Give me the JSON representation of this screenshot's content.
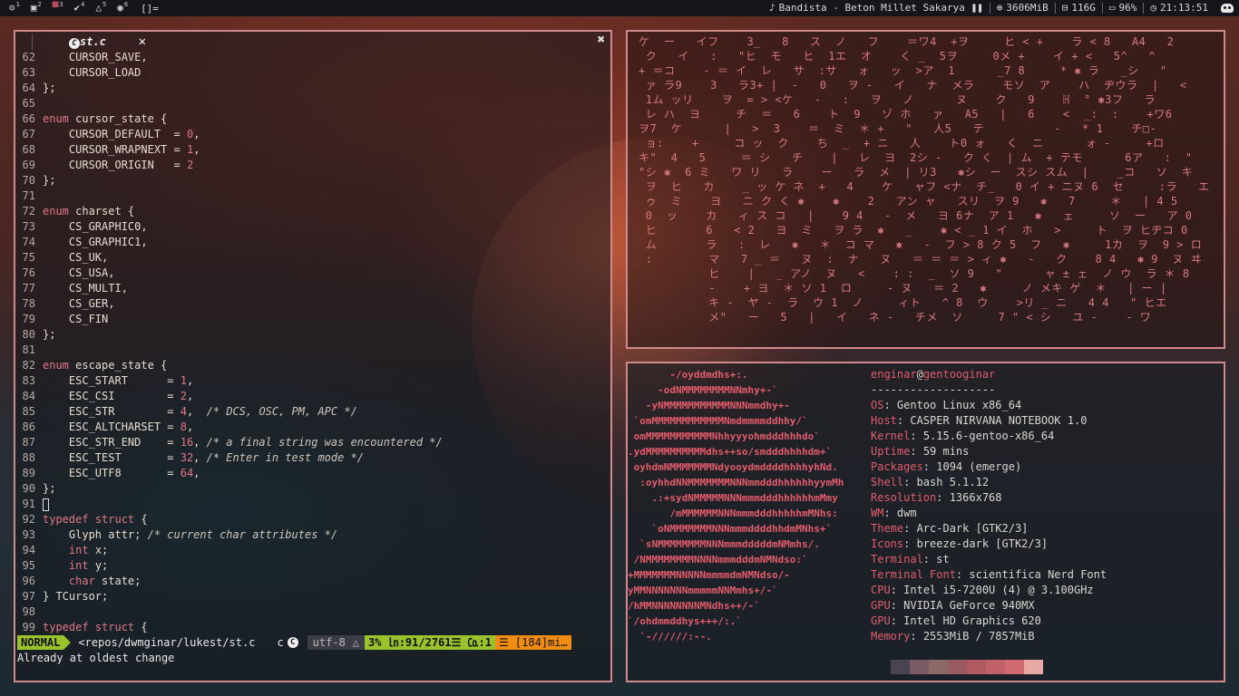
{
  "topbar": {
    "tags": [
      {
        "glyph": "⊙",
        "num": "1",
        "active": false
      },
      {
        "glyph": "▣",
        "num": "2",
        "active": false
      },
      {
        "glyph": "▀",
        "num": "3",
        "active": true
      },
      {
        "glyph": "✔",
        "num": "4",
        "active": false
      },
      {
        "glyph": "△",
        "num": "5",
        "active": false
      },
      {
        "glyph": "◉",
        "num": "6",
        "active": false
      }
    ],
    "layout": "[]=",
    "music": "Bandista - Beton Millet Sakarya",
    "pause": "❚❚",
    "memory": "3606MiB",
    "disk": "116G",
    "battery": "96%",
    "time": "21:13:51",
    "icons": {
      "music": "♪",
      "memory": "⊕",
      "disk": "⊟",
      "battery": "▭",
      "clock": "◷"
    }
  },
  "editor": {
    "tab_title": "st.c",
    "tab_icon": "C",
    "tab_close": "✕",
    "window_close": "✖",
    "lines": [
      {
        "n": "62",
        "parts": [
          {
            "t": "    CURSOR_SAVE,"
          }
        ]
      },
      {
        "n": "63",
        "parts": [
          {
            "t": "    CURSOR_LOAD"
          }
        ]
      },
      {
        "n": "64",
        "parts": [
          {
            "t": "};"
          }
        ]
      },
      {
        "n": "65",
        "parts": []
      },
      {
        "n": "66",
        "parts": [
          {
            "t": "enum",
            "c": "kw"
          },
          {
            "t": " cursor_state {"
          }
        ]
      },
      {
        "n": "67",
        "parts": [
          {
            "t": "    CURSOR_DEFAULT  = "
          },
          {
            "t": "0",
            "c": "nm"
          },
          {
            "t": ","
          }
        ]
      },
      {
        "n": "68",
        "parts": [
          {
            "t": "    CURSOR_WRAPNEXT = "
          },
          {
            "t": "1",
            "c": "nm"
          },
          {
            "t": ","
          }
        ]
      },
      {
        "n": "69",
        "parts": [
          {
            "t": "    CURSOR_ORIGIN   = "
          },
          {
            "t": "2",
            "c": "nm"
          }
        ]
      },
      {
        "n": "70",
        "parts": [
          {
            "t": "};"
          }
        ]
      },
      {
        "n": "71",
        "parts": []
      },
      {
        "n": "72",
        "parts": [
          {
            "t": "enum",
            "c": "kw"
          },
          {
            "t": " charset {"
          }
        ]
      },
      {
        "n": "73",
        "parts": [
          {
            "t": "    CS_GRAPHIC0,"
          }
        ]
      },
      {
        "n": "74",
        "parts": [
          {
            "t": "    CS_GRAPHIC1,"
          }
        ]
      },
      {
        "n": "75",
        "parts": [
          {
            "t": "    CS_UK,"
          }
        ]
      },
      {
        "n": "76",
        "parts": [
          {
            "t": "    CS_USA,"
          }
        ]
      },
      {
        "n": "77",
        "parts": [
          {
            "t": "    CS_MULTI,"
          }
        ]
      },
      {
        "n": "78",
        "parts": [
          {
            "t": "    CS_GER,"
          }
        ]
      },
      {
        "n": "79",
        "parts": [
          {
            "t": "    CS_FIN"
          }
        ]
      },
      {
        "n": "80",
        "parts": [
          {
            "t": "};"
          }
        ]
      },
      {
        "n": "81",
        "parts": []
      },
      {
        "n": "82",
        "parts": [
          {
            "t": "enum",
            "c": "kw"
          },
          {
            "t": " escape_state {"
          }
        ]
      },
      {
        "n": "83",
        "parts": [
          {
            "t": "    ESC_START      = "
          },
          {
            "t": "1",
            "c": "nm"
          },
          {
            "t": ","
          }
        ]
      },
      {
        "n": "84",
        "parts": [
          {
            "t": "    ESC_CSI        = "
          },
          {
            "t": "2",
            "c": "nm"
          },
          {
            "t": ","
          }
        ]
      },
      {
        "n": "85",
        "parts": [
          {
            "t": "    ESC_STR        = "
          },
          {
            "t": "4",
            "c": "nm"
          },
          {
            "t": ",  "
          },
          {
            "t": "/* DCS, OSC, PM, APC */",
            "c": "cm"
          }
        ]
      },
      {
        "n": "86",
        "parts": [
          {
            "t": "    ESC_ALTCHARSET = "
          },
          {
            "t": "8",
            "c": "nm"
          },
          {
            "t": ","
          }
        ]
      },
      {
        "n": "87",
        "parts": [
          {
            "t": "    ESC_STR_END    = "
          },
          {
            "t": "16",
            "c": "nm"
          },
          {
            "t": ", "
          },
          {
            "t": "/* a final string was encountered */",
            "c": "cm"
          }
        ]
      },
      {
        "n": "88",
        "parts": [
          {
            "t": "    ESC_TEST       = "
          },
          {
            "t": "32",
            "c": "nm"
          },
          {
            "t": ", "
          },
          {
            "t": "/* Enter in test mode */",
            "c": "cm"
          }
        ]
      },
      {
        "n": "89",
        "parts": [
          {
            "t": "    ESC_UTF8       = "
          },
          {
            "t": "64",
            "c": "nm"
          },
          {
            "t": ","
          }
        ]
      },
      {
        "n": "90",
        "parts": [
          {
            "t": "};"
          }
        ]
      },
      {
        "n": "91",
        "parts": [],
        "cursor": true
      },
      {
        "n": "92",
        "parts": [
          {
            "t": "typedef",
            "c": "kw"
          },
          {
            "t": " "
          },
          {
            "t": "struct",
            "c": "kw"
          },
          {
            "t": " {"
          }
        ]
      },
      {
        "n": "93",
        "parts": [
          {
            "t": "    Glyph attr; "
          },
          {
            "t": "/* current char attributes */",
            "c": "cm"
          }
        ]
      },
      {
        "n": "94",
        "parts": [
          {
            "t": "    "
          },
          {
            "t": "int",
            "c": "ty"
          },
          {
            "t": " x;"
          }
        ]
      },
      {
        "n": "95",
        "parts": [
          {
            "t": "    "
          },
          {
            "t": "int",
            "c": "ty"
          },
          {
            "t": " y;"
          }
        ]
      },
      {
        "n": "96",
        "parts": [
          {
            "t": "    "
          },
          {
            "t": "char",
            "c": "ty"
          },
          {
            "t": " state;"
          }
        ]
      },
      {
        "n": "97",
        "parts": [
          {
            "t": "} TCursor;"
          }
        ]
      },
      {
        "n": "98",
        "parts": []
      },
      {
        "n": "99",
        "parts": [
          {
            "t": "typedef",
            "c": "kw"
          },
          {
            "t": " "
          },
          {
            "t": "struct",
            "c": "kw"
          },
          {
            "t": " {"
          }
        ]
      }
    ],
    "statusline": {
      "mode": "NORMAL",
      "path": "<repos/dwmginar/lukest/st.c",
      "filetype": "c",
      "filetype_icon": "C",
      "encoding": "utf-8",
      "os_icon": "△",
      "position": "3% ㏑:91/2761☰ ㏇:1",
      "warnings": "☰ [184]mi…"
    },
    "message": "Already at oldest change"
  },
  "matrix": {
    "rows": [
      "ケ  ー   イフ    3_   8   ス  ノ   フ    ＝ワ4  +ヲ     ヒ < +    ラ < 8   A4   2",
      " ク   イ   :   \"ヒ  モ   ヒ  1エ  オ    く _  5ヲ     0メ +    イ + <   5^   ^",
      "+ ＝コ    - ＝ イ  レ   サ  :サ   ォ   ッ  >ア  1      _7 8     * ✱ ラ   _シ   \"",
      " ァ ラ9    3   ラ3+ |  -   0   ヲ -   イ   ナ  メラ    モソ  ア    ハ  ヂウラ  |   <",
      " 1ム ッリ    ヲ  = > <ケ   -   :   ヲ   ノ      ヌ    ク   9    ℍ  ° ✱3フ   ラ",
      " レ ハ  ヨ     チ  ＝   6    ト  9   ゾ ホ   ァ   A5   |   6    <  _:  :    +ワ6",
      "ヲ7  ケ      |   >  3    ＝  ミ  ＊ +   \"   人5   テ          -   * 1    チ□-",
      " ョ:    +     コ ッ  ク    ち  _  + ニ   人    ト0 ォ   く  ニ      ォ -     +ロ",
      "キ\"  4   5     ＝ シ   チ    |   レ  ヨ  2シ -   ク く  | ム  + テモ      6ア   :  \"",
      "\"シ ✱  6 ミ   ワ リ   ラ    ー   ラ  メ  | リ3   ✱シ  ー  スシ スム  |    _コ   ソ  キ",
      " ヲ  ヒ   カ    _ ッ ケ ネ  +   4    ケ   ャフ <ナ  チ_   0 イ + ニヌ 6  セ     :ラ   エ",
      " ゥ  ミ    ヨ   ニ ク く ✱    ✱    2   アン ャ   スリ  ヲ 9   ✱   7     ＊   | 4 5",
      " 0  ッ    カ   ィ ス コ   |    9 4   -  メ   ヨ 6ナ  ア 1   ✱   ェ     ソ  ー   ア 0",
      " ヒ       6   < 2   ヨ  ミ   ヲ ラ  ✱   _    ✱ < _ 1 イ  ホ   >     ト  ヲ ヒヂコ 0",
      " ム       ラ   :  レ   ✱   ＊  コ マ   ✱   -  フ > 8 ク 5  フ   ✱     1カ  ヲ  9 > ロ",
      " :        マ   7 _ ＝   ヌ  :  ナ   ヌ   ＝ ＝ ＝ > ィ ✱   -   ク    8 4   ✱ 9  ヌ ヰ",
      "          ヒ    |   _ アノ  ヌ   <    : :  _  ソ 9   \"      ャ ± ェ  ノ ウ  ラ ＊ 8",
      "          -    + ヨ  ＊ ソ 1  ロ     - ヌ   ＝ 2   ✱     ノ メキ ゲ  ＊   | ー |",
      "          キ -  ヤ -  ラ  ウ 1  ノ     ィト   ^ 8  ウ    >リ _ ニ   4 4   \" ヒエ",
      "          メ\"   ー   5   |   イ   ネ -   チメ  ソ     7 \" < シ   ユ -    - ワ"
    ]
  },
  "fetch": {
    "art": [
      "       -/oyddmdhs+:.",
      "     -odNMMMMMMMMNNmhy+-`",
      "   -yNMMMMMMMMMMMNNNmmdhy+-",
      " `omMMMMMMMMMMMMNmdmmmmddhhy/`",
      " omMMMMMMMMMMMNhhyyyohmdddhhhdo`",
      ".ydMMMMMMMMMMdhs++so/smdddhhhhdm+`",
      " oyhdmNMMMMMMMNdyooydmddddhhhhyhNd.",
      "  :oyhhdNNMMMMMMMNNNmmdddhhhhhhyymMh",
      "    .:+sydNMMMMMNNNmmmdddhhhhhhmMmy",
      "       /mMMMMMMNNNmmmdddhhhhhmMNhs:",
      "    `oNMMMMMMMNNNmmmddddhhdmMNhs+`",
      "  `sNMMMMMMMMNNNmmmdddddmNMmhs/.",
      " /NMMMMMMMMNNNNmmmdddmNMNdso:`",
      "+MMMMMMMNNNNNmmmmdmNMNdso/-",
      "yMMNNNNNNNmmmmmNNMmhs+/-`",
      "/hMMNNNNNNNNMNdhs++/-`",
      "`/ohdmmddhys+++/:.`",
      "  `-//////:--."
    ],
    "header": {
      "user": "enginar",
      "at": "@",
      "host": "gentooginar"
    },
    "separator": "-------------------",
    "info": [
      {
        "k": "OS",
        "v": "Gentoo Linux x86_64"
      },
      {
        "k": "Host",
        "v": "CASPER NIRVANA NOTEBOOK 1.0"
      },
      {
        "k": "Kernel",
        "v": "5.15.6-gentoo-x86_64"
      },
      {
        "k": "Uptime",
        "v": "59 mins"
      },
      {
        "k": "Packages",
        "v": "1094 (emerge)"
      },
      {
        "k": "Shell",
        "v": "bash 5.1.12"
      },
      {
        "k": "Resolution",
        "v": "1366x768"
      },
      {
        "k": "WM",
        "v": "dwm"
      },
      {
        "k": "Theme",
        "v": "Arc-Dark [GTK2/3]"
      },
      {
        "k": "Icons",
        "v": "breeze-dark [GTK2/3]"
      },
      {
        "k": "Terminal",
        "v": "st"
      },
      {
        "k": "Terminal Font",
        "v": "scientifica Nerd Font"
      },
      {
        "k": "CPU",
        "v": "Intel i5-7200U (4) @ 3.100GHz"
      },
      {
        "k": "GPU",
        "v": "NVIDIA GeForce 940MX"
      },
      {
        "k": "GPU",
        "v": "Intel HD Graphics 620"
      },
      {
        "k": "Memory",
        "v": "2553MiB / 7857MiB"
      }
    ],
    "palette": [
      "#4a4450",
      "#7a5a62",
      "#8a6a66",
      "#9a5a62",
      "#b05a62",
      "#c06068",
      "#d06a70",
      "#e8a8a4"
    ]
  }
}
